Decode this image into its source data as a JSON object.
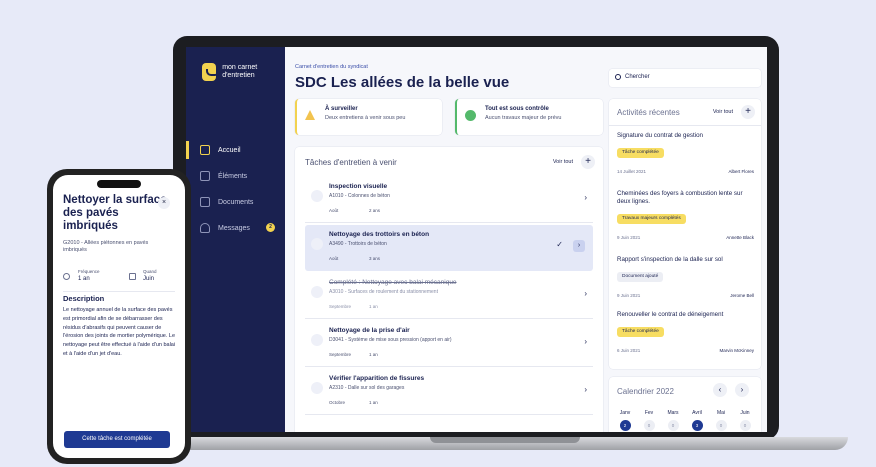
{
  "sidebar": {
    "logo": "mon carnet d'entretien",
    "items": [
      {
        "label": "Accueil"
      },
      {
        "label": "Éléments"
      },
      {
        "label": "Documents"
      },
      {
        "label": "Messages",
        "badge": "2"
      }
    ]
  },
  "header": {
    "breadcrumb": "Carnet d'entretien du syndicat",
    "title": "SDC Les allées de la belle vue"
  },
  "alerts": [
    {
      "title": "À surveiller",
      "sub": "Deux entretiens à venir sous peu"
    },
    {
      "title": "Tout est sous contrôle",
      "sub": "Aucun travaux majeur de prévu"
    }
  ],
  "tasks": {
    "title": "Tâches d'entretien à venir",
    "see_all": "Voir tout",
    "items": [
      {
        "name": "Inspection visuelle",
        "code": "A1010 - Colonnes de béton",
        "month": "Août",
        "freq": "2 ans"
      },
      {
        "name": "Nettoyage des trottoirs en béton",
        "code": "A3490 - Trottoirs de béton",
        "month": "Août",
        "freq": "3 ans"
      },
      {
        "name": "Complété : Nettoyage avec balai mécanique",
        "code": "A3010 - Surfaces de roulement du stationnement",
        "month": "Septembre",
        "freq": "1 an"
      },
      {
        "name": "Nettoyage de la prise d'air",
        "code": "D3041 - Système de mise sous pression (apport en air)",
        "month": "Septembre",
        "freq": "1 an"
      },
      {
        "name": "Vérifier l'apparition de fissures",
        "code": "A2310 - Dalle sur sol des garages",
        "month": "Octobre",
        "freq": "1 an"
      }
    ]
  },
  "search": {
    "placeholder": "Chercher"
  },
  "activities": {
    "title": "Activités récentes",
    "see_all": "Voir tout",
    "items": [
      {
        "name": "Signature du contrat de gestion",
        "tag": "Tâche complétée",
        "date": "14 Juillet 2021",
        "user": "Albert Flores"
      },
      {
        "name": "Cheminées des foyers à combustion lente sur deux lignes.",
        "tag": "Travaux majeurs complétés",
        "date": "9 Juin 2021",
        "user": "Annette Black"
      },
      {
        "name": "Rapport s'inspection de la dalle sur sol",
        "tag": "Document ajouté",
        "date": "9 Juin 2021",
        "user": "Jerome Bell"
      },
      {
        "name": "Renouveller le contrat de déneigement",
        "tag": "Tâche complétée",
        "date": "6 Juin 2021",
        "user": "Marvin McKinney"
      }
    ]
  },
  "calendar": {
    "title": "Calendrier 2022",
    "months": [
      {
        "m": "Janv",
        "c": "2"
      },
      {
        "m": "Fev",
        "c": "0"
      },
      {
        "m": "Mars",
        "c": "0"
      },
      {
        "m": "Avril",
        "c": "3"
      },
      {
        "m": "Mai",
        "c": "0"
      },
      {
        "m": "Juin",
        "c": "0"
      }
    ]
  },
  "phone": {
    "title": "Nettoyer la surface des pavés imbriqués",
    "code": "G2010 - Allées piétonnes en pavés imbriqués",
    "freq_label": "Fréquence",
    "freq": "1 an",
    "when_label": "Quand",
    "when": "Juin",
    "desc_title": "Description",
    "desc": "Le nettoyage annuel de la surface des pavés est primordial afin de se débarrasser des résidus d'abrasifs qui peuvent causer de l'érosion des joints de mortier polymérique. Le nettoyage peut être effectué à l'aide d'un balai et à l'aide d'un jet d'eau.",
    "button": "Cette tâche est complétée"
  }
}
